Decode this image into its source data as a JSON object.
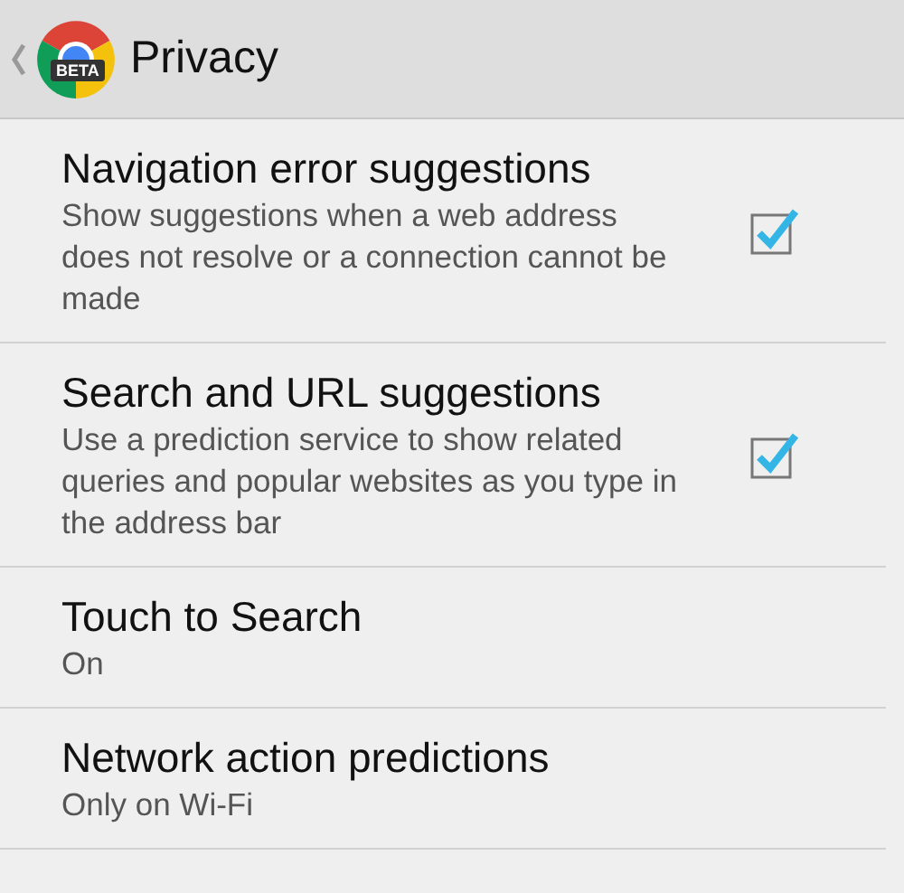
{
  "header": {
    "title": "Privacy",
    "logo_badge": "BETA"
  },
  "items": [
    {
      "kind": "checkbox",
      "title": "Navigation error suggestions",
      "summary": "Show suggestions when a web address does not resolve or a connection cannot be made",
      "checked": true
    },
    {
      "kind": "checkbox",
      "title": "Search and URL suggestions",
      "summary": "Use a prediction service to show related queries and popular websites as you type in the address bar",
      "checked": true
    },
    {
      "kind": "value",
      "title": "Touch to Search",
      "summary": "On"
    },
    {
      "kind": "value",
      "title": "Network action predictions",
      "summary": "Only on Wi-Fi"
    }
  ]
}
